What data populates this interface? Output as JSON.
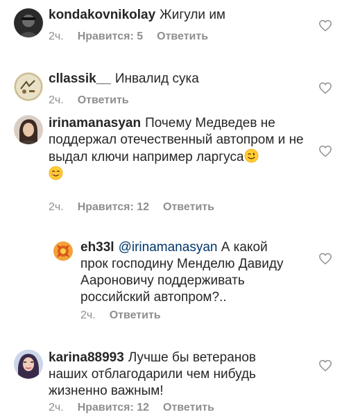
{
  "comments": [
    {
      "username": "kondakovnikolay",
      "text": "Жигули им",
      "time": "2ч.",
      "likes": "Нравится: 5",
      "reply_label": "Ответить"
    },
    {
      "username": "cllassik__",
      "text": "Инвалид сука",
      "time": "2ч.",
      "reply_label": "Ответить"
    },
    {
      "username": "irinamanasyan",
      "text": "Почему Медведев не поддержал отечественный автопром и не выдал ключи например ларгуса",
      "emojis": [
        "winking-face-emoji",
        "smiling-face-emoji"
      ],
      "time": "2ч.",
      "likes": "Нравится: 12",
      "reply_label": "Ответить"
    },
    {
      "username": "eh33l",
      "mention": "@irinamanasyan",
      "text": "А какой прок господину Менделю Давиду Аароновичу поддерживать российский автопром?..",
      "time": "2ч.",
      "reply_label": "Ответить"
    },
    {
      "username": "karina88993",
      "text": "Лучше бы ветеранов наших отблагодарили чем нибудь жизненно важным!",
      "time": "2ч.",
      "likes": "Нравится: 12",
      "reply_label": "Ответить"
    }
  ],
  "colors": {
    "text": "#262626",
    "secondary": "#8e8e8e",
    "mention": "#00376b"
  },
  "icons": {
    "like": "heart-outline-icon"
  }
}
